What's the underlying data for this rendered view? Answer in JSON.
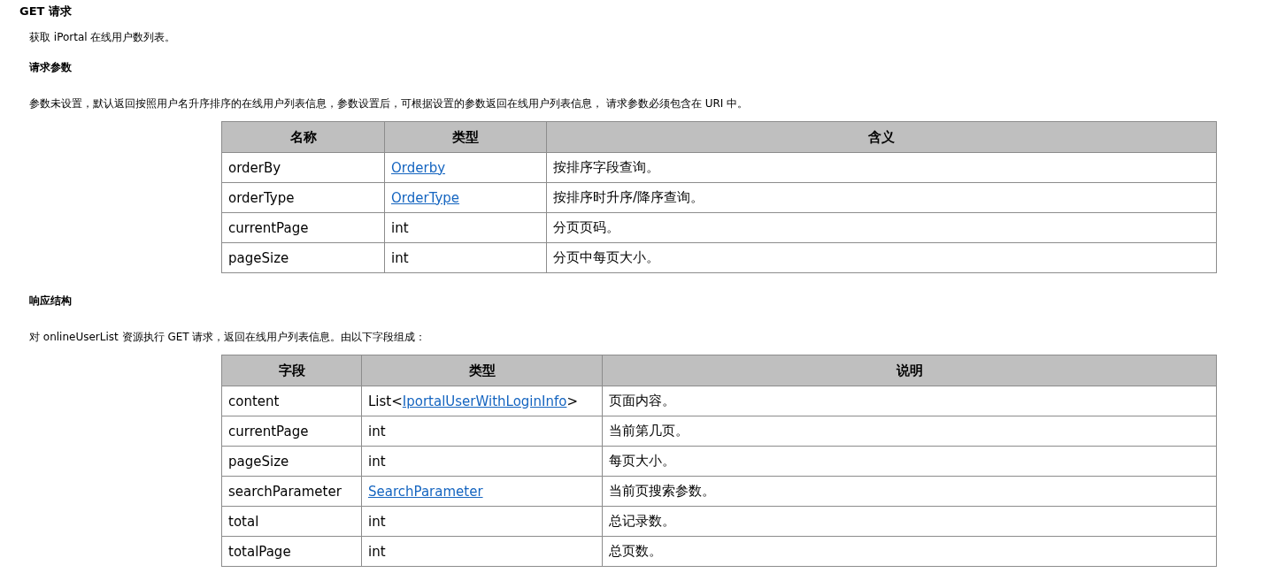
{
  "title": "GET 请求",
  "summary": "获取 iPortal 在线用户数列表。",
  "sections": [
    {
      "heading": "请求参数",
      "description": "参数未设置，默认返回按照用户名升序排序的在线用户列表信息，参数设置后，可根据设置的参数返回在线用户列表信息， 请求参数必须包含在 URI 中。",
      "columns": [
        "名称",
        "类型",
        "含义"
      ],
      "rows": [
        {
          "name": "orderBy",
          "type": {
            "kind": "link",
            "text": "Orderby"
          },
          "meaning": "按排序字段查询。"
        },
        {
          "name": "orderType",
          "type": {
            "kind": "link",
            "text": "OrderType"
          },
          "meaning": "按排序时升序/降序查询。"
        },
        {
          "name": "currentPage",
          "type": {
            "kind": "plain",
            "text": "int"
          },
          "meaning": "分页页码。"
        },
        {
          "name": "pageSize",
          "type": {
            "kind": "plain",
            "text": "int"
          },
          "meaning": "分页中每页大小。"
        }
      ]
    },
    {
      "heading": "响应结构",
      "description": "对 onlineUserList 资源执行 GET 请求，返回在线用户列表信息。由以下字段组成：",
      "columns": [
        "字段",
        "类型",
        "说明"
      ],
      "rows": [
        {
          "name": "content",
          "type": {
            "kind": "generic",
            "prefix": "List<",
            "text": "IportalUserWithLoginInfo",
            "suffix": ">"
          },
          "meaning": "页面内容。"
        },
        {
          "name": "currentPage",
          "type": {
            "kind": "plain",
            "text": "int"
          },
          "meaning": "当前第几页。"
        },
        {
          "name": "pageSize",
          "type": {
            "kind": "plain",
            "text": "int"
          },
          "meaning": "每页大小。"
        },
        {
          "name": "searchParameter",
          "type": {
            "kind": "link",
            "text": "SearchParameter"
          },
          "meaning": "当前页搜索参数。"
        },
        {
          "name": "total",
          "type": {
            "kind": "plain",
            "text": "int"
          },
          "meaning": "总记录数。"
        },
        {
          "name": "totalPage",
          "type": {
            "kind": "plain",
            "text": "int"
          },
          "meaning": "总页数。"
        }
      ]
    }
  ]
}
